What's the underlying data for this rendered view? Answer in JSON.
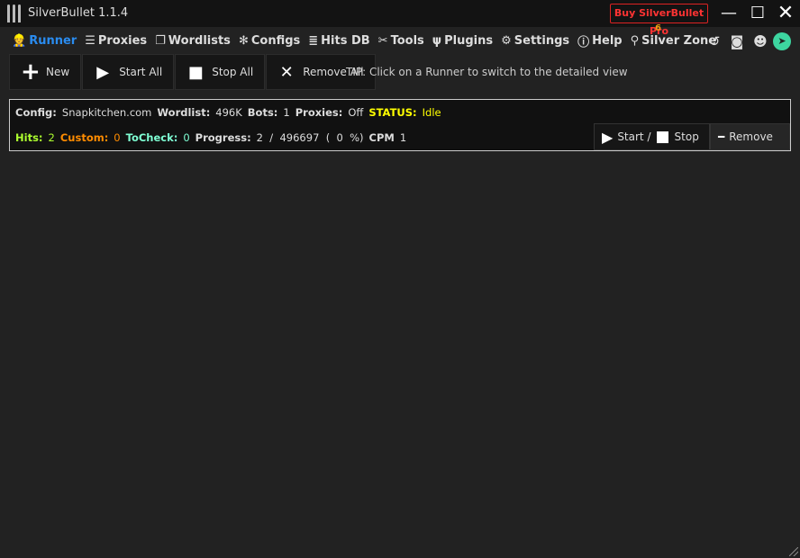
{
  "window": {
    "title": "SilverBullet 1.1.4",
    "buy_label": "Buy SilverBullet Pro"
  },
  "nav": {
    "items": [
      {
        "label": "Runner",
        "icon": "worker-icon"
      },
      {
        "label": "Proxies",
        "icon": "server-icon"
      },
      {
        "label": "Wordlists",
        "icon": "files-icon"
      },
      {
        "label": "Configs",
        "icon": "gear-wheel-icon"
      },
      {
        "label": "Hits DB",
        "icon": "database-icon"
      },
      {
        "label": "Tools",
        "icon": "tools-icon"
      },
      {
        "label": "Plugins",
        "icon": "plug-icon"
      },
      {
        "label": "Settings",
        "icon": "gear-icon"
      },
      {
        "label": "Help",
        "icon": "help-icon"
      },
      {
        "label": "Silver Zone",
        "icon": "location-icon"
      }
    ],
    "silver_zone_badge": "6"
  },
  "toolbar": {
    "new": "New",
    "start_all": "Start All",
    "stop_all": "Stop All",
    "remove_all": "Remove All",
    "tip": "TIP: Click on a Runner to switch to the detailed view"
  },
  "runner": {
    "config_label": "Config:",
    "config": "Snapkitchen.com",
    "wordlist_label": "Wordlist:",
    "wordlist": "496K",
    "bots_label": "Bots:",
    "bots": "1",
    "proxies_label": "Proxies:",
    "proxies": "Off",
    "status_label": "STATUS:",
    "status": "Idle",
    "hits_label": "Hits:",
    "hits": "2",
    "custom_label": "Custom:",
    "custom": "0",
    "tocheck_label": "ToCheck:",
    "tocheck": "0",
    "progress_label": "Progress:",
    "progress": "2  /  496697  (  0  %)",
    "cpm_label": "CPM",
    "cpm": "1",
    "start_label": "Start /",
    "stop_label": "Stop",
    "remove_label": "Remove"
  },
  "colors": {
    "accent": "#2a8cf0",
    "hits": "#adff2f",
    "custom": "#ff8c00",
    "tocheck": "#7fffd4",
    "status": "#ffff00"
  }
}
